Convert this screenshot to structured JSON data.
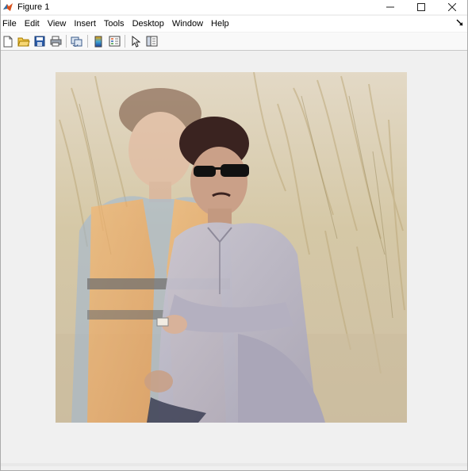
{
  "window": {
    "title": "Figure 1",
    "controls": {
      "minimize": "—",
      "maximize": "☐",
      "close": "✕"
    }
  },
  "menubar": {
    "items": [
      "File",
      "Edit",
      "View",
      "Insert",
      "Tools",
      "Desktop",
      "Window",
      "Help"
    ]
  },
  "toolbar": {
    "buttons": [
      {
        "name": "new-figure-icon"
      },
      {
        "name": "open-file-icon"
      },
      {
        "name": "save-icon"
      },
      {
        "name": "print-icon"
      },
      {
        "name": "link-plot-icon"
      },
      {
        "name": "insert-colorbar-icon"
      },
      {
        "name": "insert-legend-icon"
      },
      {
        "name": "edit-plot-icon"
      },
      {
        "name": "show-plot-tools-icon"
      }
    ]
  },
  "image": {
    "description_icon": "double-exposure-photo",
    "colors": {
      "background": "#d9cdb2",
      "grass": "#c9b98f",
      "sky": "#e4ddd0",
      "shirt": "#b9b6c4",
      "vest": "#e8a868",
      "hair": "#3a2320"
    }
  }
}
